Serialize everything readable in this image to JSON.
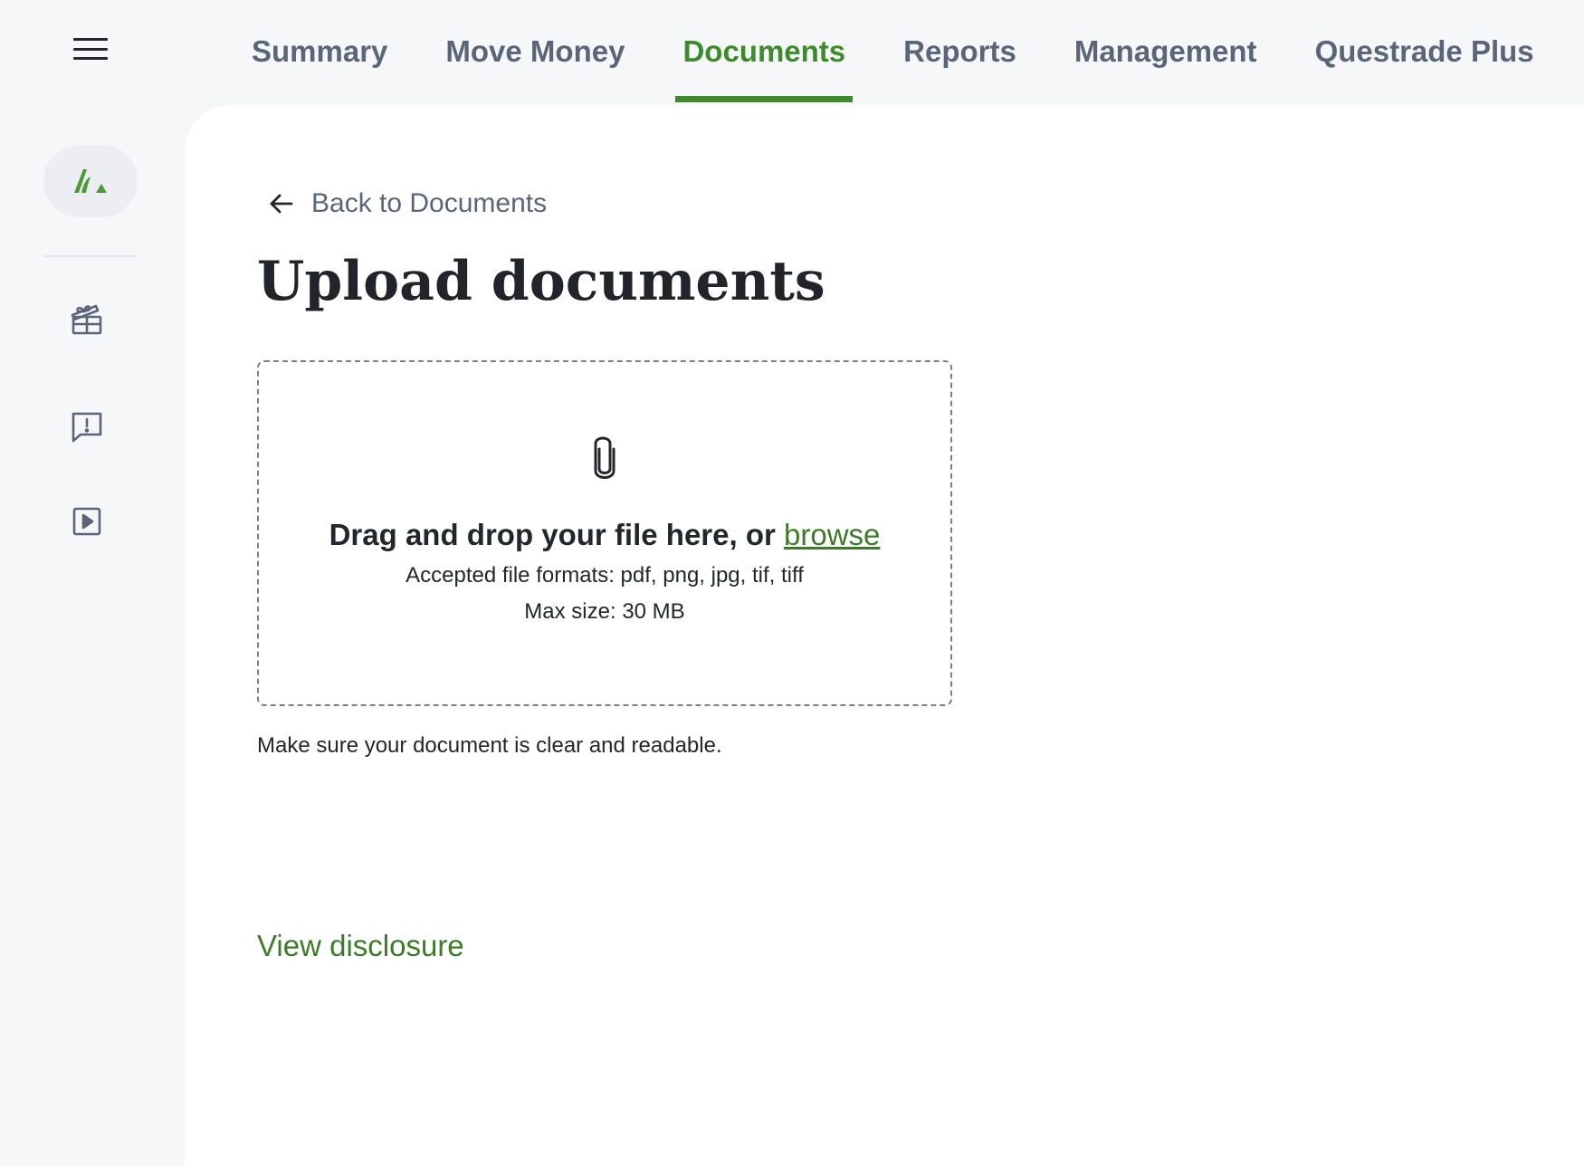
{
  "nav": {
    "menu_icon": "hamburger-menu-icon",
    "tabs": [
      {
        "label": "Summary",
        "active": false
      },
      {
        "label": "Move Money",
        "active": false
      },
      {
        "label": "Documents",
        "active": true
      },
      {
        "label": "Reports",
        "active": false
      },
      {
        "label": "Management",
        "active": false
      },
      {
        "label": "Questrade Plus",
        "active": false
      }
    ]
  },
  "rail": {
    "logo_icon": "questrade-logo-icon",
    "icons": [
      "gift-icon",
      "feedback-icon",
      "video-play-icon"
    ]
  },
  "main": {
    "back_label": "Back to Documents",
    "title": "Upload documents",
    "dropzone": {
      "icon": "paperclip-icon",
      "prompt": "Drag and drop your file here, or ",
      "browse_label": "browse",
      "formats": "Accepted file formats: pdf, png, jpg, tif, tiff",
      "max_size": "Max size: 30 MB"
    },
    "hint": "Make sure your document is clear and readable.",
    "disclosure_label": "View disclosure"
  },
  "colors": {
    "accent": "#3f8a2c",
    "link": "#3f7a2a",
    "nav_text": "#5a6678",
    "background": "#f6f7f9",
    "panel": "#ffffff"
  }
}
